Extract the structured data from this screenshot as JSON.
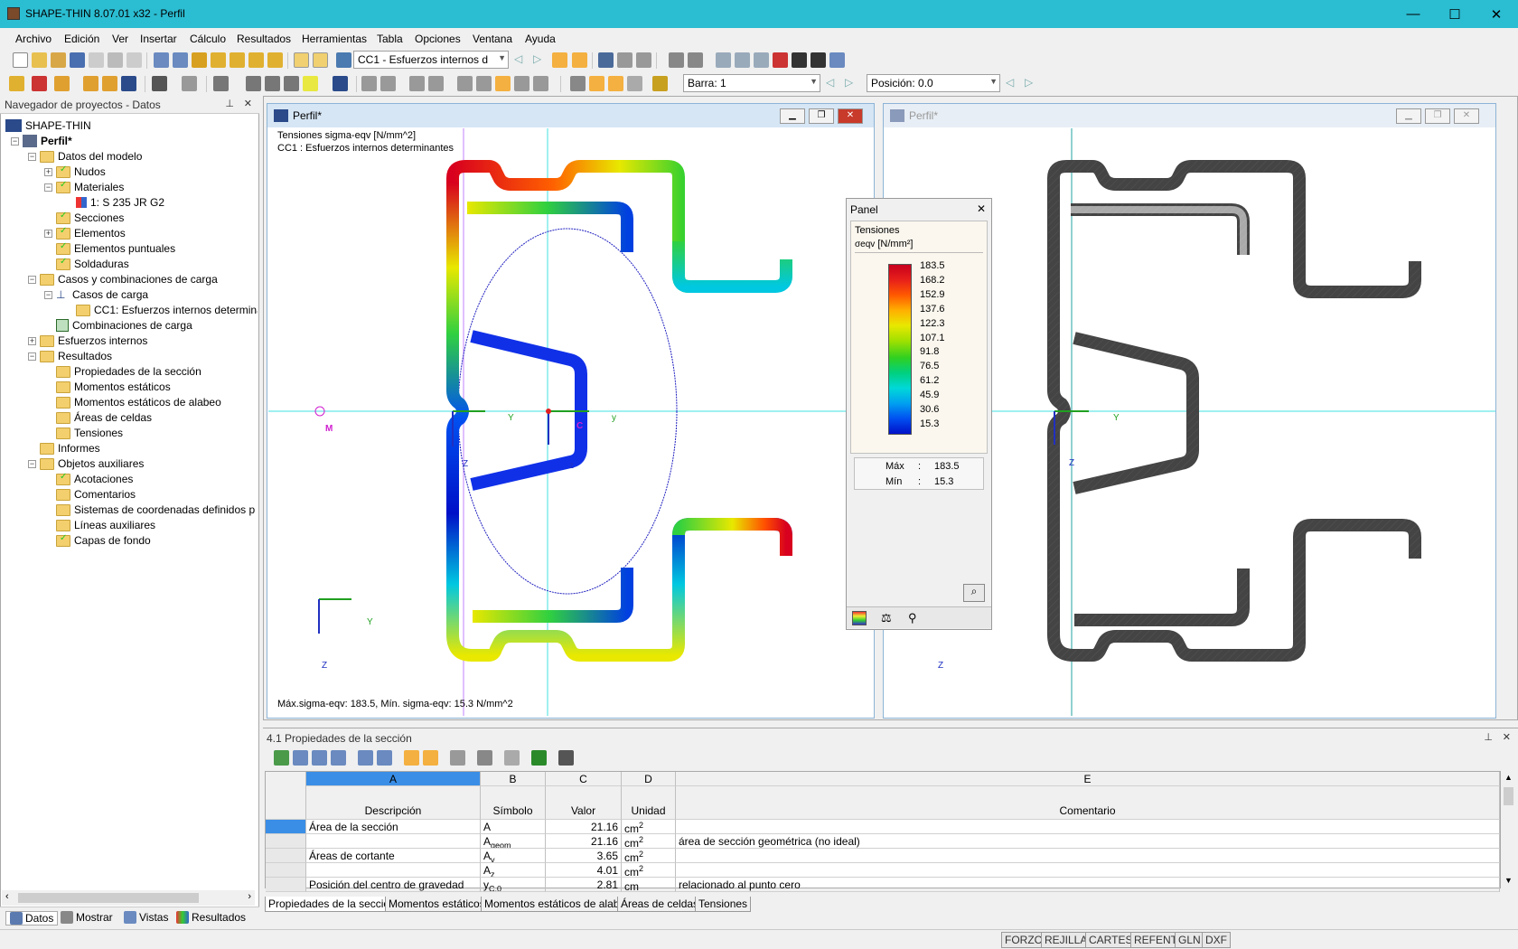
{
  "window": {
    "title": "SHAPE-THIN 8.07.01 x32 - Perfil",
    "minimize": "—",
    "maximize": "☐",
    "close": "✕"
  },
  "menu": [
    "Archivo",
    "Edición",
    "Ver",
    "Insertar",
    "Cálculo",
    "Resultados",
    "Herramientas",
    "Tabla",
    "Opciones",
    "Ventana",
    "Ayuda"
  ],
  "toolbar": {
    "loadcase_combo": "CC1 - Esfuerzos internos d",
    "bar_combo": "Barra: 1",
    "position_combo": "Posición: 0.0"
  },
  "navigator": {
    "title": "Navegador de proyectos - Datos",
    "items": [
      {
        "label": "SHAPE-THIN",
        "level": 0,
        "bold": false
      },
      {
        "label": "Perfil*",
        "level": 1,
        "bold": true
      },
      {
        "label": "Datos del modelo",
        "level": 2
      },
      {
        "label": "Nudos",
        "level": 3
      },
      {
        "label": "Materiales",
        "level": 3
      },
      {
        "label": "1: S 235 JR G2",
        "level": 4
      },
      {
        "label": "Secciones",
        "level": 3
      },
      {
        "label": "Elementos",
        "level": 3
      },
      {
        "label": "Elementos puntuales",
        "level": 3
      },
      {
        "label": "Soldaduras",
        "level": 3
      },
      {
        "label": "Casos y combinaciones de carga",
        "level": 2
      },
      {
        "label": "Casos de carga",
        "level": 3
      },
      {
        "label": "CC1: Esfuerzos internos determina",
        "level": 4
      },
      {
        "label": "Combinaciones de carga",
        "level": 3
      },
      {
        "label": "Esfuerzos internos",
        "level": 2
      },
      {
        "label": "Resultados",
        "level": 2
      },
      {
        "label": "Propiedades de la sección",
        "level": 3
      },
      {
        "label": "Momentos estáticos",
        "level": 3
      },
      {
        "label": "Momentos estáticos de alabeo",
        "level": 3
      },
      {
        "label": "Áreas de celdas",
        "level": 3
      },
      {
        "label": "Tensiones",
        "level": 3
      },
      {
        "label": "Informes",
        "level": 2
      },
      {
        "label": "Objetos auxiliares",
        "level": 2
      },
      {
        "label": "Acotaciones",
        "level": 3
      },
      {
        "label": "Comentarios",
        "level": 3
      },
      {
        "label": "Sistemas de coordenadas definidos p",
        "level": 3
      },
      {
        "label": "Líneas auxiliares",
        "level": 3
      },
      {
        "label": "Capas de fondo",
        "level": 3
      }
    ],
    "tabs": [
      "Datos",
      "Mostrar",
      "Vistas",
      "Resultados"
    ]
  },
  "view_left": {
    "title": "Perfil*",
    "info1": "Tensiones sigma-eqv [N/mm^2]",
    "info2": "CC1 : Esfuerzos internos determinantes",
    "footer": "Máx.sigma-eqv: 183.5, Mín. sigma-eqv: 15.3 N/mm^2",
    "axis_y": "Y",
    "axis_z": "Z",
    "axis_y_small": "y",
    "axis_z_small": "z",
    "point_m": "M",
    "point_c": "C"
  },
  "view_right": {
    "title": "Perfil*",
    "axis_y": "Y",
    "axis_z": "Z"
  },
  "panel": {
    "title": "Panel",
    "heading": "Tensiones",
    "unit_symbol": "σeqv",
    "unit": "[N/mm²]",
    "scale": [
      "183.5",
      "168.2",
      "152.9",
      "137.6",
      "122.3",
      "107.1",
      "91.8",
      "76.5",
      "61.2",
      "45.9",
      "30.6",
      "15.3"
    ],
    "max_label": "Máx",
    "max_value": "183.5",
    "min_label": "Mín",
    "min_value": "15.3",
    "colors": [
      "#c8001e",
      "#e8201a",
      "#ff5a00",
      "#ffb000",
      "#e8e800",
      "#a0e000",
      "#30d020",
      "#00d080",
      "#00d8d8",
      "#00a0f0",
      "#0050f0",
      "#0010c8"
    ]
  },
  "table": {
    "title": "4.1 Propiedades de la sección",
    "col_letters": [
      "A",
      "B",
      "C",
      "D",
      "E"
    ],
    "headers": [
      "Descripción",
      "Símbolo",
      "Valor",
      "Unidad",
      "Comentario"
    ],
    "rows": [
      {
        "desc": "Área de la sección",
        "sym": "A",
        "sym_sub": "",
        "val": "21.16",
        "unit": "cm",
        "unit_sup": "2",
        "comment": ""
      },
      {
        "desc": "",
        "sym": "A",
        "sym_sub": "geom",
        "val": "21.16",
        "unit": "cm",
        "unit_sup": "2",
        "comment": "área de sección geométrica (no ideal)"
      },
      {
        "desc": "Áreas de cortante",
        "sym": "A",
        "sym_sub": "y",
        "val": "3.65",
        "unit": "cm",
        "unit_sup": "2",
        "comment": ""
      },
      {
        "desc": "",
        "sym": "A",
        "sym_sub": "z",
        "val": "4.01",
        "unit": "cm",
        "unit_sup": "2",
        "comment": ""
      },
      {
        "desc": "Posición del centro de gravedad",
        "sym": "y",
        "sym_sub": "C,0",
        "val": "2.81",
        "unit": "cm",
        "unit_sup": "",
        "comment": "relacionado al punto cero"
      }
    ],
    "tabs": [
      "Propiedades de la sección",
      "Momentos estáticos",
      "Momentos estáticos de alabeo",
      "Áreas de celdas",
      "Tensiones"
    ]
  },
  "statusbar": [
    "FORZC",
    "REJILLA",
    "CARTES",
    "REFENT",
    "GLN",
    "DXF"
  ]
}
